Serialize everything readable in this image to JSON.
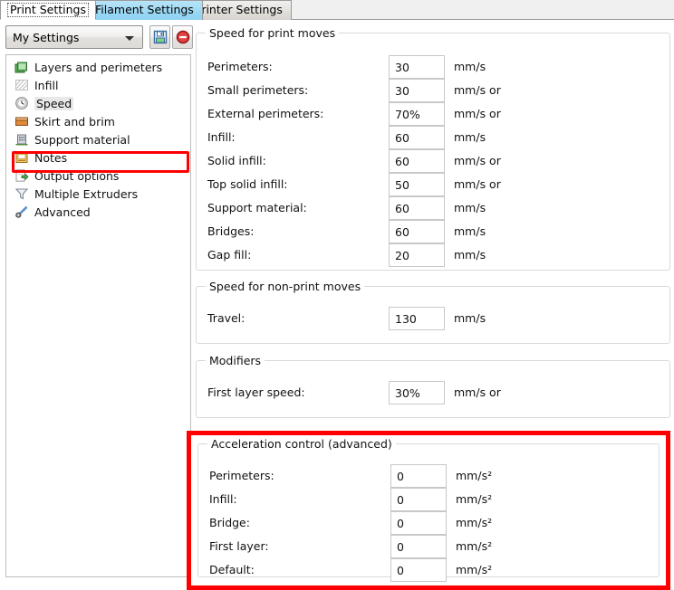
{
  "tabs": [
    {
      "label": "Print Settings",
      "state": "active"
    },
    {
      "label": "Filament Settings",
      "state": "hover"
    },
    {
      "label": "Printer Settings",
      "state": "normal"
    }
  ],
  "preset": {
    "selected": "My Settings",
    "save_title": "Save preset",
    "delete_title": "Delete preset"
  },
  "sidebar": {
    "items": [
      {
        "label": "Layers and perimeters",
        "icon": "layers-icon"
      },
      {
        "label": "Infill",
        "icon": "infill-hatch-icon"
      },
      {
        "label": "Speed",
        "icon": "clock-icon"
      },
      {
        "label": "Skirt and brim",
        "icon": "box-icon"
      },
      {
        "label": "Support material",
        "icon": "building-icon"
      },
      {
        "label": "Notes",
        "icon": "notes-icon"
      },
      {
        "label": "Output options",
        "icon": "export-arrow-icon"
      },
      {
        "label": "Multiple Extruders",
        "icon": "funnel-icon"
      },
      {
        "label": "Advanced",
        "icon": "wrench-icon"
      }
    ],
    "selected_index": 2,
    "highlight_color": "#ff0000"
  },
  "groups": [
    {
      "title": "Speed for print moves",
      "fields": [
        {
          "label": "Perimeters:",
          "value": "30",
          "unit": "mm/s"
        },
        {
          "label": "Small perimeters:",
          "value": "30",
          "unit": "mm/s or"
        },
        {
          "label": "External perimeters:",
          "value": "70%",
          "unit": "mm/s or"
        },
        {
          "label": "Infill:",
          "value": "60",
          "unit": "mm/s"
        },
        {
          "label": "Solid infill:",
          "value": "60",
          "unit": "mm/s or"
        },
        {
          "label": "Top solid infill:",
          "value": "50",
          "unit": "mm/s or"
        },
        {
          "label": "Support material:",
          "value": "60",
          "unit": "mm/s"
        },
        {
          "label": "Bridges:",
          "value": "60",
          "unit": "mm/s"
        },
        {
          "label": "Gap fill:",
          "value": "20",
          "unit": "mm/s"
        }
      ]
    },
    {
      "title": "Speed for non-print moves",
      "fields": [
        {
          "label": "Travel:",
          "value": "130",
          "unit": "mm/s"
        }
      ]
    },
    {
      "title": "Modifiers",
      "fields": [
        {
          "label": "First layer speed:",
          "value": "30%",
          "unit": "mm/s or"
        }
      ]
    },
    {
      "title": "Acceleration control (advanced)",
      "highlighted": true,
      "fields": [
        {
          "label": "Perimeters:",
          "value": "0",
          "unit": "mm/s²"
        },
        {
          "label": "Infill:",
          "value": "0",
          "unit": "mm/s²"
        },
        {
          "label": "Bridge:",
          "value": "0",
          "unit": "mm/s²"
        },
        {
          "label": "First layer:",
          "value": "0",
          "unit": "mm/s²"
        },
        {
          "label": "Default:",
          "value": "0",
          "unit": "mm/s²"
        }
      ]
    }
  ]
}
